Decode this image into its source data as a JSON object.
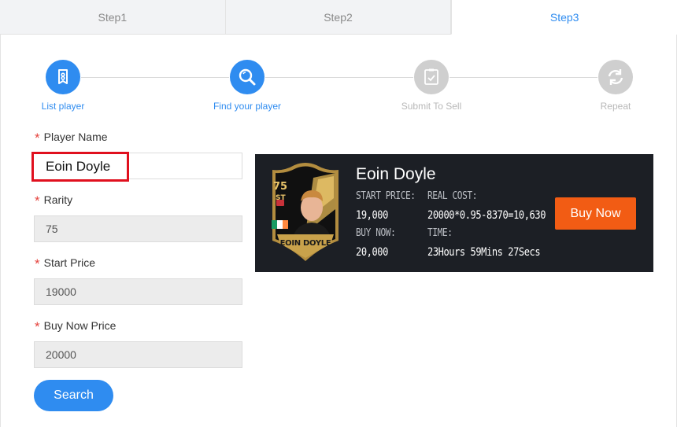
{
  "tabs": [
    {
      "label": "Step1"
    },
    {
      "label": "Step2"
    },
    {
      "label": "Step3"
    }
  ],
  "stepper": {
    "steps": [
      {
        "label": "List player",
        "icon": "tag-icon"
      },
      {
        "label": "Find your player",
        "icon": "search-icon"
      },
      {
        "label": "Submit To Sell",
        "icon": "checklist-icon"
      },
      {
        "label": "Repeat",
        "icon": "refresh-icon"
      }
    ]
  },
  "form": {
    "player_name": {
      "label": "Player Name",
      "value": "Eoin Doyle"
    },
    "rarity": {
      "label": "Rarity",
      "value": "75"
    },
    "start_price": {
      "label": "Start Price",
      "value": "19000"
    },
    "buy_now_price": {
      "label": "Buy Now Price",
      "value": "20000"
    },
    "search_label": "Search"
  },
  "player_card": {
    "name": "Eoin Doyle",
    "start_price_label": "START PRICE:",
    "start_price_value": "19,000",
    "buy_now_label": "BUY NOW:",
    "buy_now_value": "20,000",
    "real_cost_label": "REAL COST:",
    "real_cost_value": "20000*0.95-8370=10,630",
    "time_label": "TIME:",
    "time_value": "23Hours 59Mins 27Secs",
    "buy_label": "Buy Now",
    "fut_card": {
      "rating": "75",
      "position": "ST",
      "name": "EOIN DOYLE"
    }
  },
  "colors": {
    "accent": "#2f8cf0",
    "buy": "#f25c14",
    "card_bg": "#1c1f25",
    "highlight": "#e0101e"
  }
}
